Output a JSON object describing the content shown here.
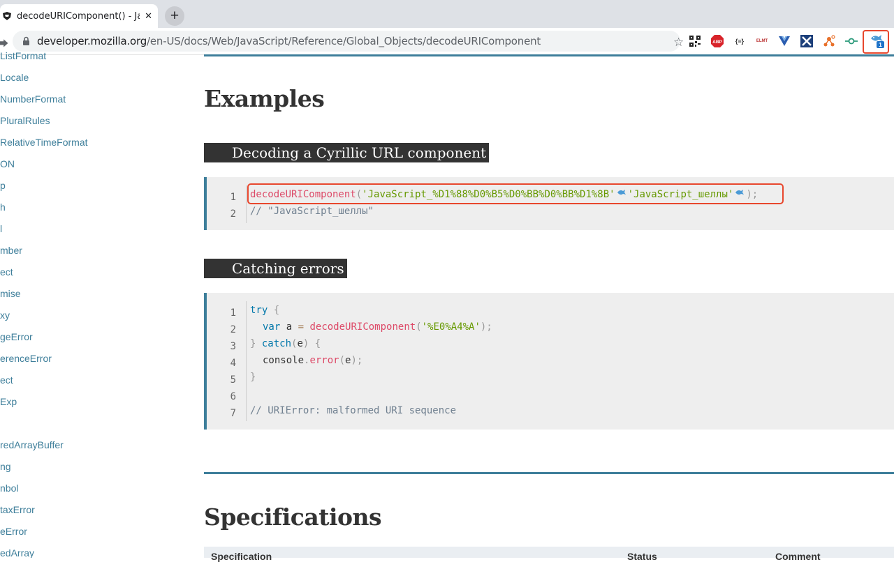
{
  "browser": {
    "tab_title": "decodeURIComponent() - Java",
    "tab_close": "✕",
    "new_tab": "+",
    "url_host": "developer.mozilla.org",
    "url_path": "/en-US/docs/Web/JavaScript/Reference/Global_Objects/decodeURIComponent",
    "extensions": [
      "qr-code",
      "adblock-plus",
      "json-formatter",
      "elmt",
      "vue-devtools",
      "x-extension",
      "network-tool",
      "git-commit",
      "highlighted-fish-extension"
    ],
    "ext_labels": {
      "abp": "ABP",
      "json": "{≡}",
      "elmt": "ELMT",
      "badge": "1"
    }
  },
  "sidebar": {
    "items": [
      "ListFormat",
      "Locale",
      "NumberFormat",
      "PluralRules",
      "RelativeTimeFormat",
      "ON",
      "p",
      "h",
      "l",
      "mber",
      "ect",
      "mise",
      "xy",
      "geError",
      "erenceError",
      "ect",
      "Exp",
      "",
      "redArrayBuffer",
      "ng",
      "nbol",
      "taxError",
      "eError",
      "edArray"
    ]
  },
  "content": {
    "examples_heading": "Examples",
    "section1_heading": "Decoding a Cyrillic URL component",
    "section2_heading": "Catching errors",
    "specifications_heading": "Specifications",
    "code1": {
      "line_numbers": [
        "1",
        "2"
      ],
      "line1_fn": "decodeURIComponent",
      "line1_open": "(",
      "line1_arg": "'JavaScript_%D1%88%D0%B5%D0%BB%D0%BB%D1%8B'",
      "line1_result": "'JavaScript_шеллы'",
      "line1_close": ");",
      "line2": "// \"JavaScript_шеллы\""
    },
    "code2": {
      "line_numbers": [
        "1",
        "2",
        "3",
        "4",
        "5",
        "6",
        "7"
      ],
      "try_kw": "try",
      "brace_open": " {",
      "var_kw": "var",
      "var_name": " a ",
      "eq": "=",
      "fn": "decodeURIComponent",
      "paren_open": "(",
      "arg": "'%E0%A4%A'",
      "paren_close": ");",
      "brace_close": "}",
      "catch_kw": "catch",
      "catch_param_open": "(",
      "catch_param": "e",
      "catch_param_close": ")",
      "console": "console",
      "dot": ".",
      "error_fn": "error",
      "err_open": "(",
      "err_arg": "e",
      "err_close": ");",
      "comment": "// URIError: malformed URI sequence"
    },
    "table_headers": [
      "Specification",
      "Status",
      "Comment"
    ]
  },
  "colors": {
    "link": "#3d7e9a",
    "heading_bg": "#333333",
    "code_bg": "#eeeeee",
    "highlight": "#e8472d"
  }
}
